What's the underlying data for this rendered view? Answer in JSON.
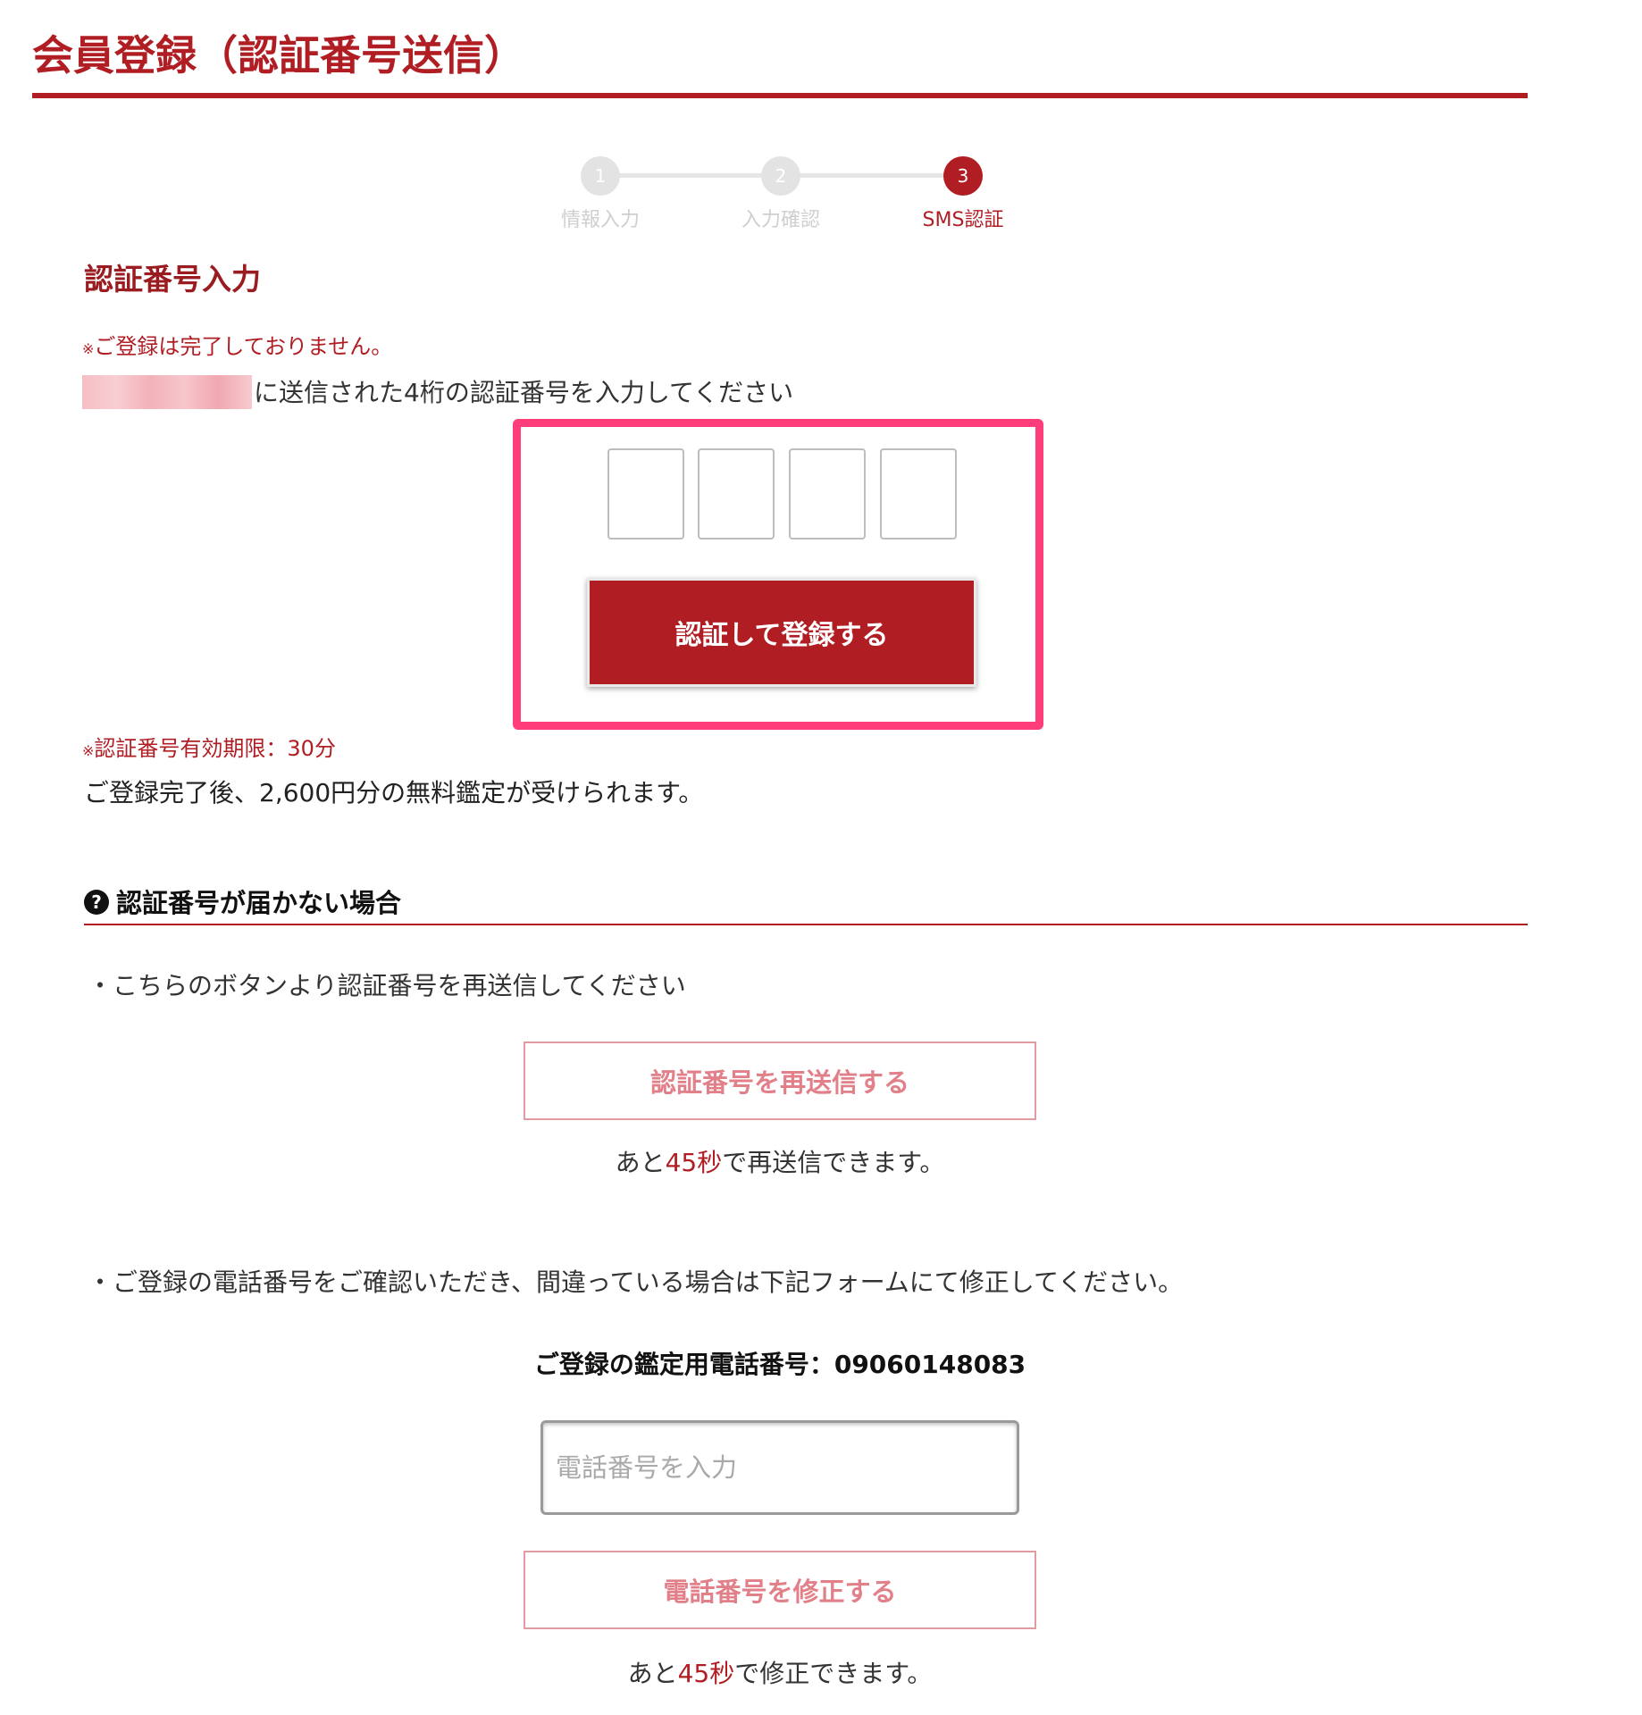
{
  "header": {
    "title": "会員登録（認証番号送信）"
  },
  "stepper": {
    "steps": [
      {
        "number": "1",
        "label": "情報入力",
        "active": false
      },
      {
        "number": "2",
        "label": "入力確認",
        "active": false
      },
      {
        "number": "3",
        "label": "SMS認証",
        "active": true
      }
    ]
  },
  "verify": {
    "heading": "認証番号入力",
    "notice_mark": "※",
    "notice": "ご登録は完了しておりません。",
    "instruction": "に送信された4桁の認証番号を入力してください",
    "code_digits": [
      "",
      "",
      "",
      ""
    ],
    "submit_label": "認証して登録する",
    "expiry_mark": "※",
    "expiry": "認証番号有効期限：30分",
    "bonus": "ご登録完了後、2,600円分の無料鑑定が受けられます。"
  },
  "help": {
    "icon": "question-circle-icon",
    "heading": "認証番号が届かない場合",
    "bullet_resend": "・こちらのボタンより認証番号を再送信してください",
    "resend_label": "認証番号を再送信する",
    "resend_countdown": {
      "prefix": "あと",
      "seconds": "45秒",
      "suffix": "で再送信できます。"
    },
    "bullet_fix": "・ご登録の電話番号をご確認いただき、間違っている場合は下記フォームにて修正してください。",
    "phone_label": "ご登録の鑑定用電話番号：09060148083",
    "phone_placeholder": "電話番号を入力",
    "phone_value": "",
    "fix_label": "電話番号を修正する",
    "fix_countdown": {
      "prefix": "あと",
      "seconds": "45秒",
      "suffix": "で修正できます。"
    }
  },
  "colors": {
    "brand": "#b01e24",
    "highlight": "#ff3d7a",
    "outline_button_text": "#e2808a",
    "step_inactive": "#e3e3e3"
  }
}
